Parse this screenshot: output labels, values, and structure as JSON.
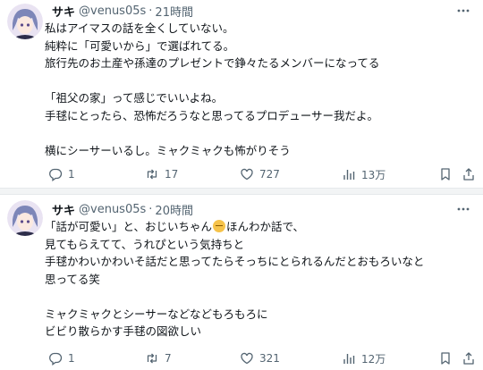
{
  "tweets": [
    {
      "name": "サキ",
      "handle": "@venus05s",
      "separator": "·",
      "time": "21時間",
      "lines": [
        "私はアイマスの話を全くしていない。",
        "純粋に「可愛いから」で選ばれてる。",
        "旅行先のお土産や孫達のプレゼントで錚々たるメンバーになってる",
        "",
        "「祖父の家」って感じでいいよね。",
        "手毬にとったら、恐怖だろうなと思ってるプロデューサー我だよ。",
        "",
        "横にシーサーいるし。ミャクミャクも怖がりそう"
      ],
      "replies": "1",
      "retweets": "17",
      "likes": "727",
      "views": "13万"
    },
    {
      "name": "サキ",
      "handle": "@venus05s",
      "separator": "·",
      "time": "20時間",
      "line1_a": "「話が可愛い」と、おじいちゃん",
      "line1_b": "ほんわか話で、",
      "lines": [
        "見てもらえてて、うれぴという気持ちと",
        "手毬かわいかわいそ話だと思ってたらそっちにとられるんだとおもろいなと",
        "思ってる笑",
        "",
        "ミャクミャクとシーサーなどなどもろもろに",
        "ビビり散らかす手毬の図欲しい"
      ],
      "replies": "1",
      "retweets": "7",
      "likes": "321",
      "views": "12万"
    }
  ],
  "icons": {
    "reply": "reply-icon",
    "retweet": "retweet-icon",
    "like": "heart-icon",
    "views": "views-icon",
    "bookmark": "bookmark-icon",
    "share": "share-icon",
    "more": "more-icon",
    "emoji": "smiling-face-emoji"
  },
  "colors": {
    "text": "#0f1419",
    "secondary": "#536471",
    "separator": "#f2f4f5"
  }
}
